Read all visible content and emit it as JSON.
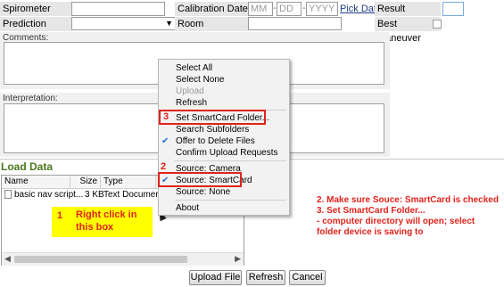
{
  "form": {
    "spirometer_label": "Spirometer",
    "calibration_label": "Calibration Date",
    "date_mm": "MM",
    "date_dd": "DD",
    "date_yyyy": "YYYY",
    "date_sep": "-",
    "pick_date": "Pick Date",
    "result_label": "Result",
    "prediction_label": "Prediction Method",
    "room_temp_label": "Room Temperature",
    "best_maneuver_label": "Best Maneuver",
    "comments_label": "Comments:",
    "interpretation_label": "Interpretation:"
  },
  "load_data": {
    "title": "Load Data",
    "columns": [
      "Name",
      "Size",
      "Type"
    ],
    "file": {
      "name": "basic nav script...",
      "size": "3 KB",
      "type": "Text Document"
    }
  },
  "context_menu": {
    "items": [
      {
        "label": "Select All"
      },
      {
        "label": "Select None"
      },
      {
        "label": "Upload"
      },
      {
        "label": "Refresh"
      },
      {
        "label": "Set SmartCard Folder..."
      },
      {
        "label": "Search Subfolders"
      },
      {
        "label": "Offer to Delete Files"
      },
      {
        "label": "Confirm Upload Requests"
      },
      {
        "label": "Source: Camera"
      },
      {
        "label": "Source: SmartCard"
      },
      {
        "label": "Source: None"
      },
      {
        "label": "About"
      }
    ]
  },
  "annotations": {
    "num1": "1",
    "num2": "2",
    "num3": "3",
    "callout1_line1": "Right click in",
    "callout1_line2": "this box",
    "instr_line1": "2. Make sure Souce: SmartCard is checked",
    "instr_line2": "3. Set SmartCard Folder...",
    "instr_line3": "- computer directory will open; select",
    "instr_line4": "folder device is saving to"
  },
  "buttons": {
    "upload": "Upload File",
    "refresh": "Refresh",
    "cancel": "Cancel"
  },
  "colors": {
    "annotation_red": "#e0231b",
    "callout_yellow": "#ffff00",
    "load_data_green": "#4a7a1e",
    "check_blue": "#2a6fd6"
  }
}
